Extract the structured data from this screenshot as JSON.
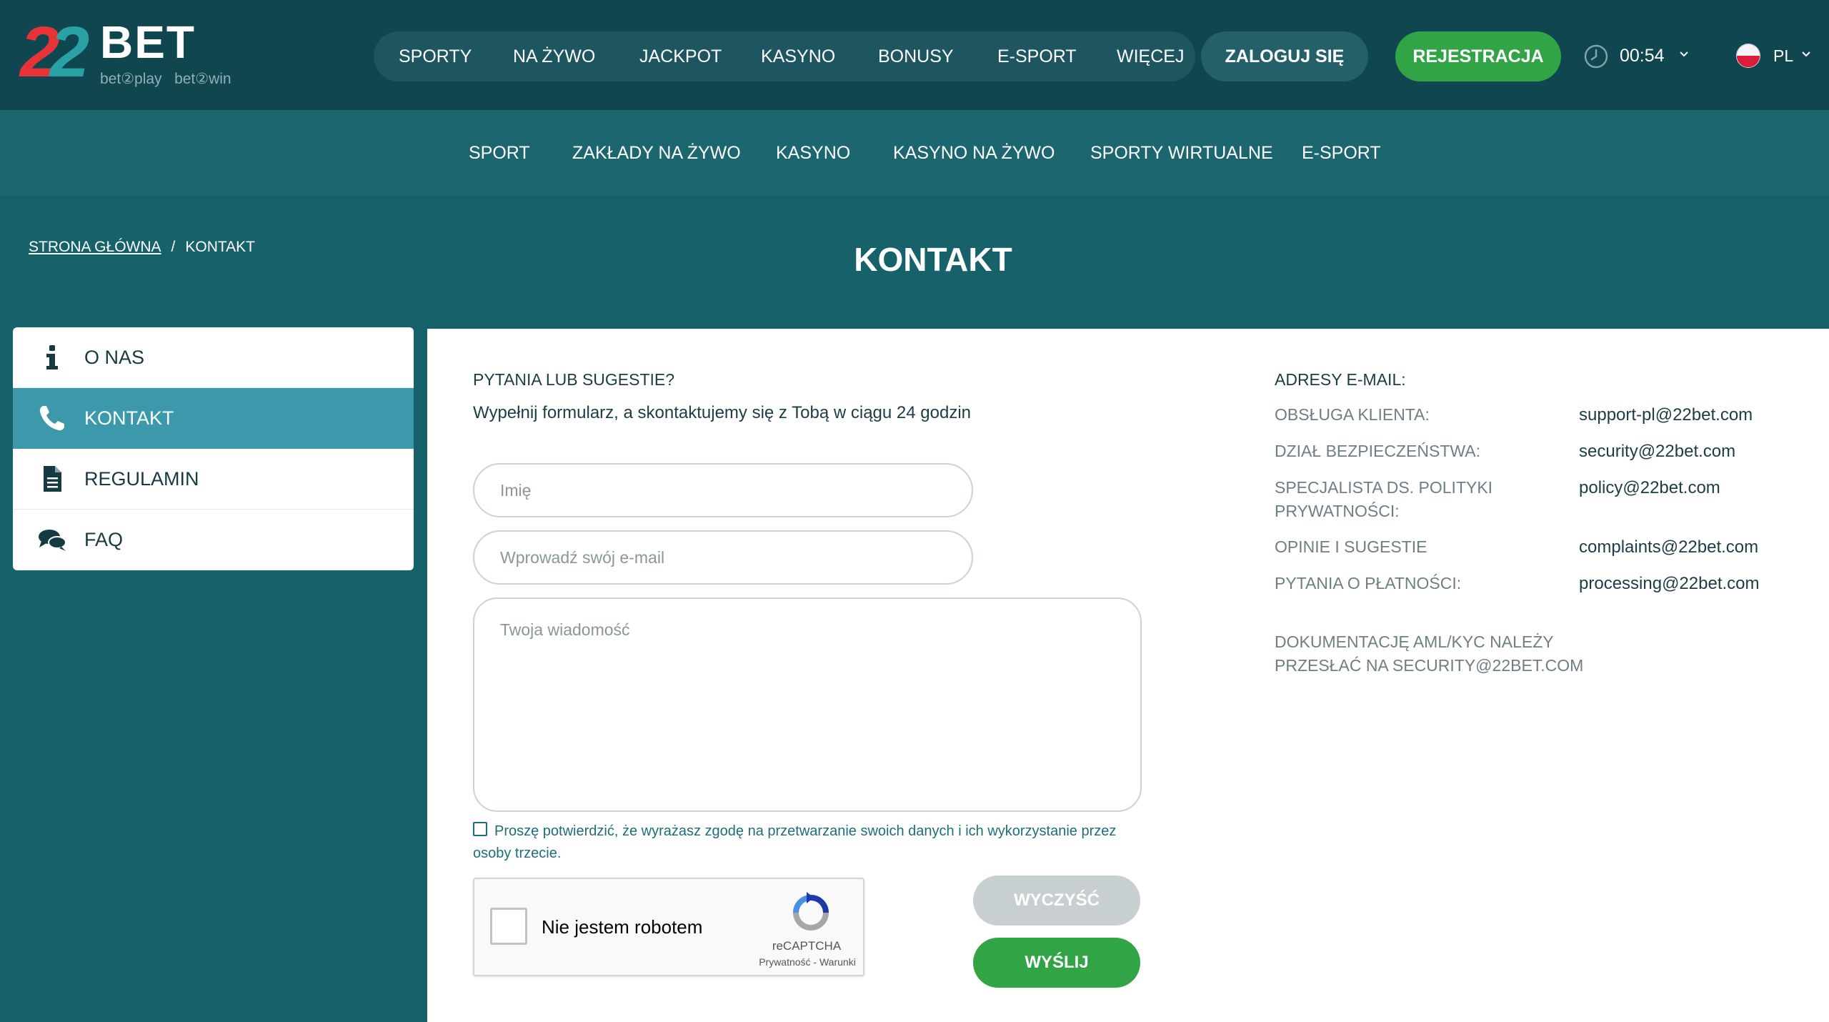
{
  "header": {
    "logo": {
      "number": "22",
      "brand": "BET",
      "tagline_left": "bet②play",
      "tagline_right": "bet②win"
    },
    "nav": [
      "SPORTY",
      "NA ŻYWO",
      "JACKPOT",
      "KASYNO",
      "BONUSY",
      "E-SPORT",
      "WIĘCEJ"
    ],
    "login_label": "ZALOGUJ SIĘ",
    "register_label": "REJESTRACJA",
    "time": "00:54",
    "language": "PL"
  },
  "subnav": [
    "SPORT",
    "ZAKŁADY NA ŻYWO",
    "KASYNO",
    "KASYNO NA ŻYWO",
    "SPORTY WIRTUALNE",
    "E-SPORT"
  ],
  "breadcrumb": {
    "home": "STRONA GŁÓWNA",
    "separator": "/",
    "current": "KONTAKT"
  },
  "page_title": "KONTAKT",
  "sidebar": {
    "items": [
      {
        "label": "O NAS",
        "icon": "info-icon",
        "active": false
      },
      {
        "label": "KONTAKT",
        "icon": "phone-icon",
        "active": true
      },
      {
        "label": "REGULAMIN",
        "icon": "document-icon",
        "active": false
      },
      {
        "label": "FAQ",
        "icon": "chat-icon",
        "active": false
      }
    ]
  },
  "form": {
    "title": "PYTANIA LUB SUGESTIE?",
    "subtitle": "Wypełnij formularz, a skontaktujemy się z Tobą w ciągu 24 godzin",
    "name_placeholder": "Imię",
    "name_value": "",
    "email_placeholder": "Wprowadź swój e-mail",
    "email_value": "",
    "message_placeholder": "Twoja wiadomość",
    "message_value": "",
    "consent_checked": false,
    "consent_text": "Proszę potwierdzić, że wyrażasz zgodę na przetwarzanie swoich danych i ich wykorzystanie przez osoby trzecie.",
    "captcha": {
      "label": "Nie jestem robotem",
      "brand": "reCAPTCHA",
      "terms": "Prywatność - Warunki"
    },
    "clear_label": "WYCZYŚĆ",
    "send_label": "WYŚLIJ"
  },
  "emails": {
    "title": "ADRESY E-MAIL:",
    "rows": [
      {
        "label": "OBSŁUGA KLIENTA:",
        "value": "support-pl@22bet.com"
      },
      {
        "label": "DZIAŁ BEZPIECZEŃSTWA:",
        "value": "security@22bet.com"
      },
      {
        "label": "SPECJALISTA DS. POLITYKI PRYWATNOŚCI:",
        "value": "policy@22bet.com"
      },
      {
        "label": "OPINIE I SUGESTIE",
        "value": "complaints@22bet.com"
      },
      {
        "label": "PYTANIA O PŁATNOŚCI:",
        "value": "processing@22bet.com"
      }
    ],
    "aml_note": "DOKUMENTACJĘ AML/KYC NALEŻY PRZESŁAĆ NA SECURITY@22BET.COM"
  },
  "colors": {
    "header_bg": "#0f4650",
    "page_bg": "#17626a",
    "accent_green": "#31a546",
    "active_sidebar": "#3c98ab",
    "logo_red": "#e63338",
    "logo_teal": "#2aa1a5"
  }
}
